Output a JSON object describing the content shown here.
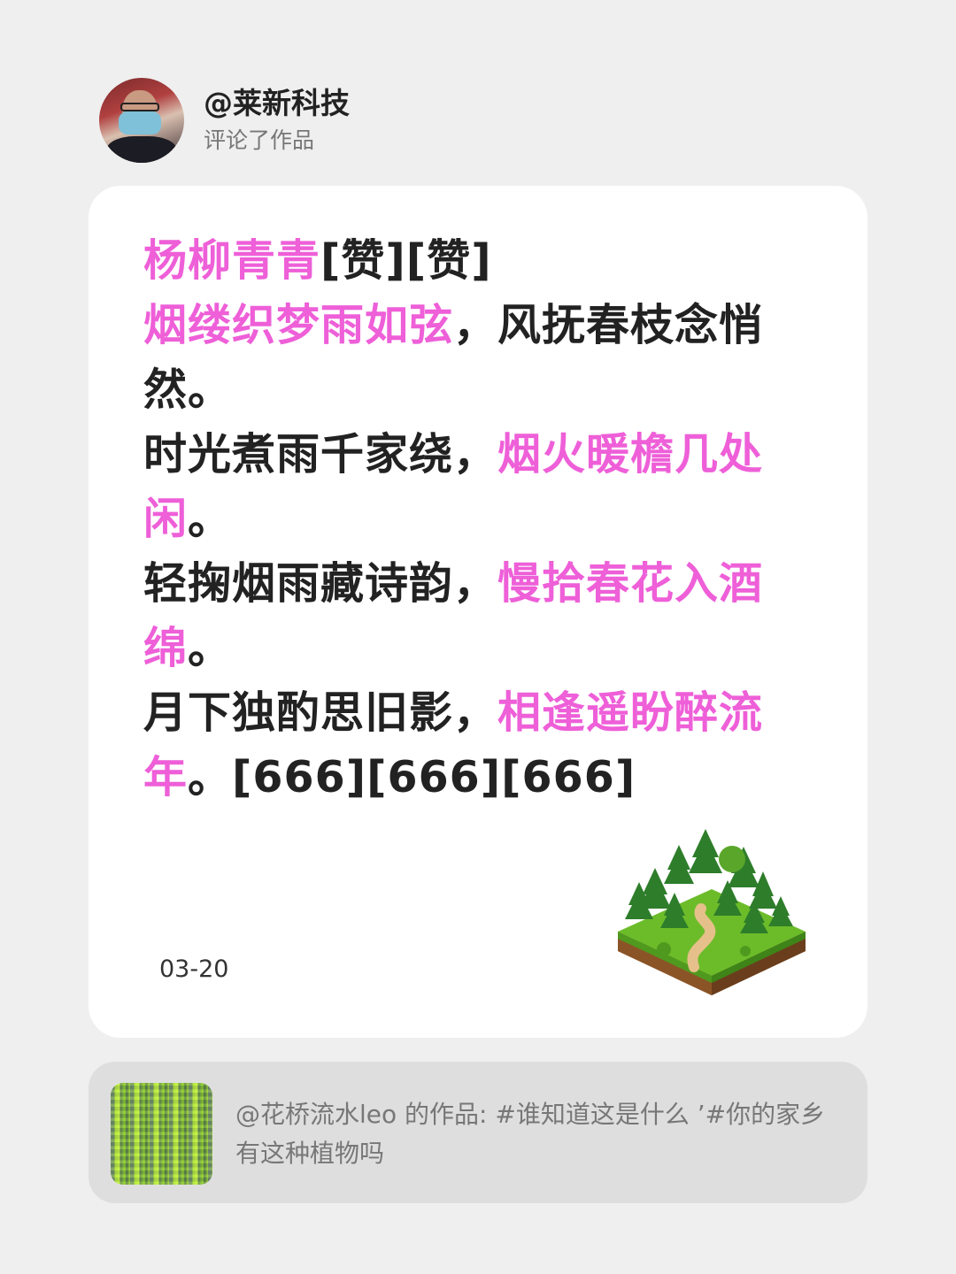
{
  "header": {
    "username": "@莱新科技",
    "action": "评论了作品"
  },
  "comment": {
    "lines": [
      [
        {
          "text": "杨柳青青",
          "pink": true
        },
        {
          "text": "[赞][赞]",
          "pink": false
        }
      ],
      [
        {
          "text": "烟缕织梦雨如弦",
          "pink": true
        },
        {
          "text": "，风抚春枝念悄",
          "pink": false
        }
      ],
      [
        {
          "text": "然。",
          "pink": false
        }
      ],
      [
        {
          "text": "时光煮雨千家绕，",
          "pink": false
        },
        {
          "text": "烟火暖檐几处",
          "pink": true
        }
      ],
      [
        {
          "text": "闲",
          "pink": true
        },
        {
          "text": "。",
          "pink": false
        }
      ],
      [
        {
          "text": "轻掬烟雨藏诗韵，",
          "pink": false
        },
        {
          "text": "慢拾春花入酒",
          "pink": true
        }
      ],
      [
        {
          "text": "绵",
          "pink": true
        },
        {
          "text": "。",
          "pink": false
        }
      ],
      [
        {
          "text": "月下独酌思旧影，",
          "pink": false
        },
        {
          "text": "相逢遥盼醉流",
          "pink": true
        }
      ],
      [
        {
          "text": "年",
          "pink": true
        },
        {
          "text": "。[666][666][666]",
          "pink": false
        }
      ]
    ],
    "date": "03-20"
  },
  "quote": {
    "text": "@花桥流水leo 的作品: #谁知道这是什么 ’#你的家乡有这种植物吗"
  },
  "colors": {
    "background": "#efefef",
    "card": "#ffffff",
    "highlight": "#ee5fd8",
    "text": "#222222",
    "muted": "#777777"
  }
}
